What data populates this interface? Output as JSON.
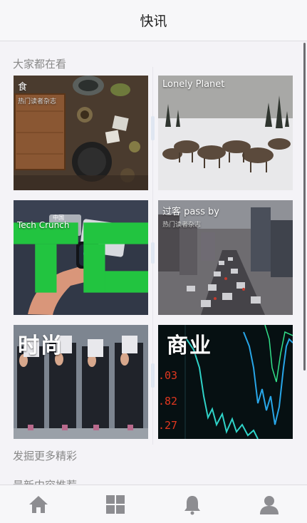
{
  "header": {
    "title": "快讯"
  },
  "sections": {
    "popular_title": "大家都在看",
    "discover_title": "发掘更多精彩",
    "latest_title": "最新内容推荐"
  },
  "tiles": [
    {
      "label": "食",
      "sub": "热门读者杂志"
    },
    {
      "label": "Lonely Planet",
      "sub": ""
    },
    {
      "label": "Tech Crunch",
      "sub": "中国"
    },
    {
      "label": "过客 pass by",
      "sub": "热门读者杂志"
    },
    {
      "label": "时尚",
      "sub": ""
    },
    {
      "label": "商业",
      "sub": ""
    }
  ],
  "nav": [
    {
      "icon": "home-icon"
    },
    {
      "icon": "grid-icon"
    },
    {
      "icon": "bell-icon"
    },
    {
      "icon": "user-icon"
    }
  ],
  "colors": {
    "accent_green": "#22c440",
    "icon_gray": "#8d8d91",
    "background": "#f4f3f7"
  }
}
